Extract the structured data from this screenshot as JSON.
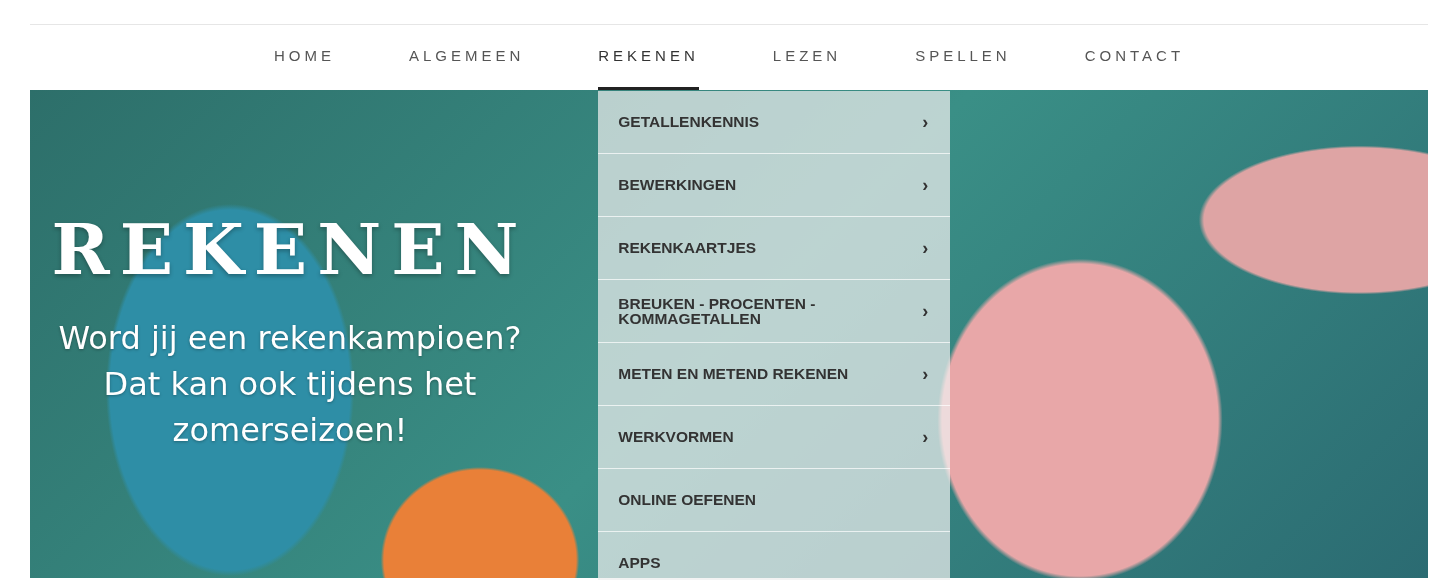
{
  "nav": {
    "items": [
      {
        "label": "HOME",
        "selected": false
      },
      {
        "label": "ALGEMEEN",
        "selected": false
      },
      {
        "label": "REKENEN",
        "selected": true
      },
      {
        "label": "LEZEN",
        "selected": false
      },
      {
        "label": "SPELLEN",
        "selected": false
      },
      {
        "label": "CONTACT",
        "selected": false
      }
    ]
  },
  "dropdown": {
    "items": [
      {
        "label": "GETALLENKENNIS",
        "submenu_arrow": "›"
      },
      {
        "label": "BEWERKINGEN",
        "submenu_arrow": "›"
      },
      {
        "label": "REKENKAARTJES",
        "submenu_arrow": "›"
      },
      {
        "label": "BREUKEN - PROCENTEN - KOMMAGETALLEN",
        "submenu_arrow": "›"
      },
      {
        "label": "METEN EN METEND REKENEN",
        "submenu_arrow": "›"
      },
      {
        "label": "WERKVORMEN",
        "submenu_arrow": "›"
      },
      {
        "label": "ONLINE OEFENEN"
      },
      {
        "label": "APPS"
      }
    ]
  },
  "hero": {
    "title": "REKENEN",
    "subtitle": "Word jij een rekenkampioen? Dat kan ook tijdens het zomerseizoen!"
  }
}
